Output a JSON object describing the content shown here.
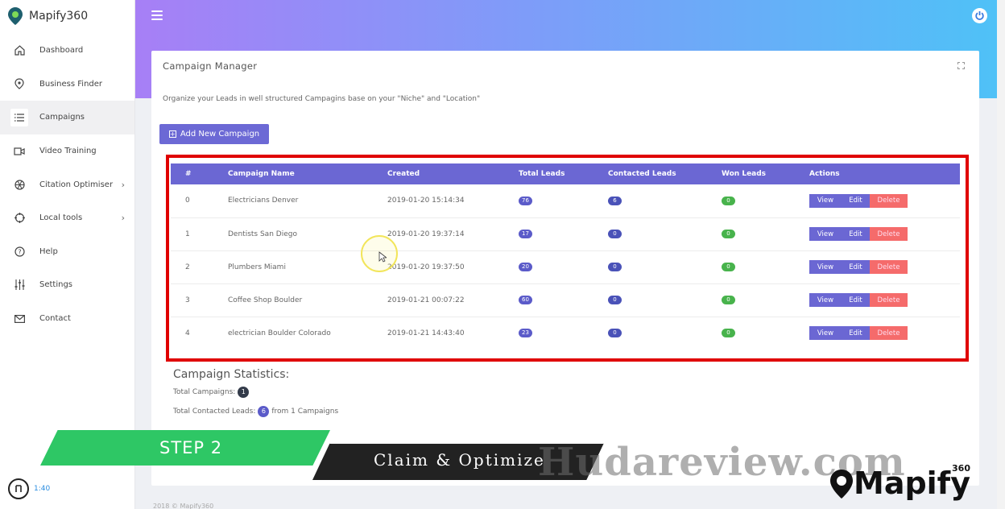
{
  "app": {
    "name": "Mapify360"
  },
  "sidebar": {
    "items": [
      {
        "label": "Dashboard",
        "icon": "home-icon"
      },
      {
        "label": "Business Finder",
        "icon": "location-pin-icon"
      },
      {
        "label": "Campaigns",
        "icon": "list-icon",
        "active": true
      },
      {
        "label": "Video Training",
        "icon": "video-icon"
      },
      {
        "label": "Citation Optimiser",
        "icon": "aperture-icon",
        "submenu": true
      },
      {
        "label": "Local tools",
        "icon": "crosshair-icon",
        "submenu": true
      },
      {
        "label": "Help",
        "icon": "help-icon"
      },
      {
        "label": "Settings",
        "icon": "sliders-icon"
      },
      {
        "label": "Contact",
        "icon": "mail-icon"
      }
    ]
  },
  "card": {
    "title": "Campaign Manager",
    "description": "Organize your Leads in well structured Campagins base on your \"Niche\" and \"Location\"",
    "add_button": "Add New Campaign"
  },
  "table": {
    "headers": [
      "#",
      "Campaign Name",
      "Created",
      "Total Leads",
      "Contacted Leads",
      "Won Leads",
      "Actions"
    ],
    "rows": [
      {
        "idx": "0",
        "name": "Electricians Denver",
        "created": "2019-01-20 15:14:34",
        "total": "76",
        "contacted": "6",
        "won": "0"
      },
      {
        "idx": "1",
        "name": "Dentists San Diego",
        "created": "2019-01-20 19:37:14",
        "total": "17",
        "contacted": "0",
        "won": "0"
      },
      {
        "idx": "2",
        "name": "Plumbers Miami",
        "created": "2019-01-20 19:37:50",
        "total": "20",
        "contacted": "0",
        "won": "0"
      },
      {
        "idx": "3",
        "name": "Coffee Shop Boulder",
        "created": "2019-01-21 00:07:22",
        "total": "60",
        "contacted": "0",
        "won": "0"
      },
      {
        "idx": "4",
        "name": "electrician Boulder Colorado",
        "created": "2019-01-21 14:43:40",
        "total": "23",
        "contacted": "0",
        "won": "0"
      }
    ],
    "actions": {
      "view": "View",
      "edit": "Edit",
      "delete": "Delete"
    }
  },
  "stats": {
    "title": "Campaign Statistics:",
    "total_campaigns_label": "Total Campaigns:",
    "total_campaigns_value": "1",
    "contacted_label": "Total Contacted Leads:",
    "contacted_value": "6",
    "contacted_suffix": "from 1 Campaigns"
  },
  "footer": {
    "text": "2018 © Mapify360"
  },
  "overlay": {
    "step": "STEP 2",
    "claim": "Claim & Optimize",
    "watermark": "Hudareview.com",
    "logo_word": "Mapify",
    "logo_sup": "360",
    "video_time": "1:40"
  },
  "colors": {
    "accent": "#6b67d3",
    "delete": "#f56b6b",
    "won": "#48b34c",
    "highlight": "#e00000",
    "step": "#2ec765"
  }
}
